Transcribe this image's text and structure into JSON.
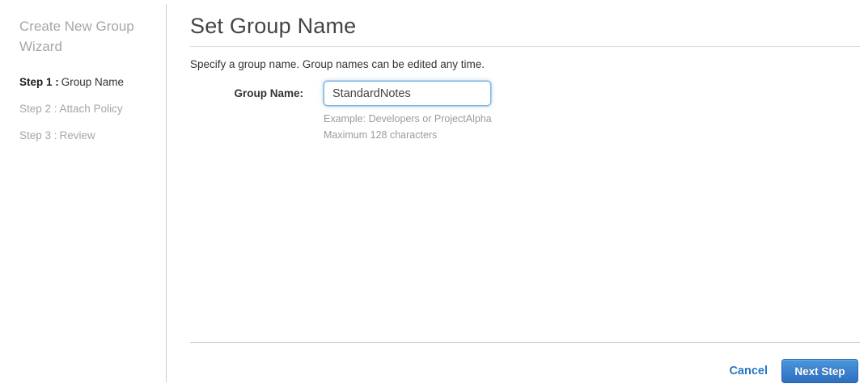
{
  "sidebar": {
    "title": "Create New Group Wizard",
    "steps": [
      {
        "prefix": "Step 1 :",
        "label": "Group Name"
      },
      {
        "prefix": "Step 2 :",
        "label": "Attach Policy"
      },
      {
        "prefix": "Step 3 :",
        "label": "Review"
      }
    ]
  },
  "main": {
    "title": "Set Group Name",
    "description": "Specify a group name. Group names can be edited any time.",
    "form": {
      "label": "Group Name:",
      "value": "StandardNotes",
      "hint_line1": "Example: Developers or ProjectAlpha",
      "hint_line2": "Maximum 128 characters"
    },
    "footer": {
      "cancel_label": "Cancel",
      "next_label": "Next Step"
    }
  },
  "colors": {
    "accent_blue": "#2a76c2",
    "button_gradient_top": "#4a97dd",
    "button_gradient_bottom": "#2d6fc0",
    "input_focus_border": "#7db2e0",
    "muted_gray": "#a6a6a6",
    "divider_gray": "#cccccc"
  }
}
